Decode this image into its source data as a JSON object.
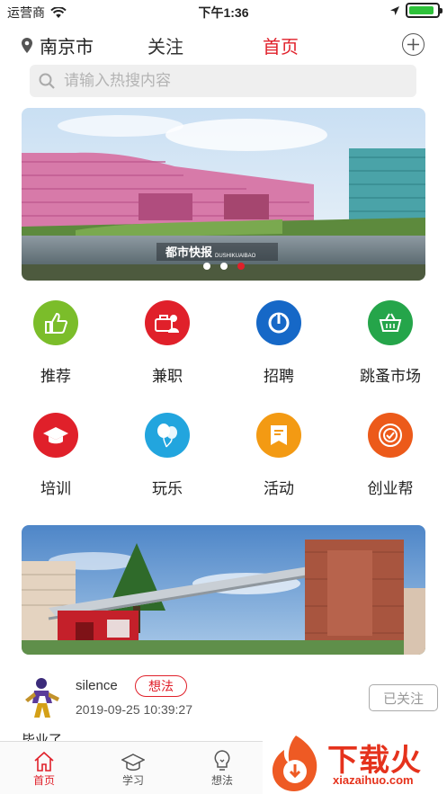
{
  "status_bar": {
    "carrier": "运营商",
    "time": "下午1:36",
    "battery_level": 0.9
  },
  "nav": {
    "city": "南京市",
    "tab_follow": "关注",
    "tab_home": "首页",
    "add_icon": "plus-circle-icon"
  },
  "search": {
    "placeholder": "请输入热搜内容",
    "value": ""
  },
  "banner": {
    "slides": 3,
    "active_slide": 3,
    "sign_text": "都市快报",
    "sign_sub": "DUSHIKUAIBAO"
  },
  "categories": [
    {
      "label": "推荐",
      "icon": "thumbs-up-icon",
      "color": "#7bbd2a"
    },
    {
      "label": "兼职",
      "icon": "briefcase-person-icon",
      "color": "#e0202a"
    },
    {
      "label": "招聘",
      "icon": "power-icon",
      "color": "#1668c7"
    },
    {
      "label": "跳蚤市场",
      "icon": "basket-icon",
      "color": "#25a54a"
    },
    {
      "label": "培训",
      "icon": "graduation-cap-icon",
      "color": "#e0202a"
    },
    {
      "label": "玩乐",
      "icon": "balloons-icon",
      "color": "#22a5de"
    },
    {
      "label": "活动",
      "icon": "flag-card-icon",
      "color": "#f39a13"
    },
    {
      "label": "创业帮",
      "icon": "target-badge-icon",
      "color": "#ec5a1a"
    }
  ],
  "post": {
    "username": "silence",
    "tag": "想法",
    "timestamp": "2019-09-25 10:39:27",
    "follow_label": "已关注",
    "text": "毕业了"
  },
  "tabbar": {
    "tabs": [
      {
        "label": "首页",
        "icon": "home-icon"
      },
      {
        "label": "学习",
        "icon": "graduation-cap-outline-icon"
      },
      {
        "label": "想法",
        "icon": "lightbulb-icon"
      }
    ]
  },
  "watermark": {
    "brand": "下载火",
    "url": "xiazaihuo.com"
  },
  "colors": {
    "accent": "#e0202a"
  }
}
